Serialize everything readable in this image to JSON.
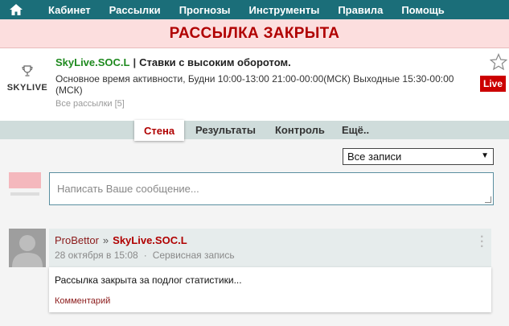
{
  "nav": {
    "home_icon": "home-icon",
    "items": [
      "Кабинет",
      "Рассылки",
      "Прогнозы",
      "Инструменты",
      "Правила",
      "Помощь"
    ]
  },
  "banner": {
    "text": "РАССЫЛКА ЗАКРЫТА",
    "color": "#b00000"
  },
  "channel": {
    "logo_text": "SKYLIVE",
    "name": "SkyLive.SOC.L",
    "separator": "|",
    "description": "Ставки с высоким оборотом.",
    "active_time": "Основное время активности, Будни 10:00-13:00 21:00-00:00(МСК) Выходные 15:30-00:00 (МСК)",
    "all_mailings": "Все рассылки [5]",
    "live_badge": "Live",
    "live_color": "#cc0000",
    "name_color": "#1f8a1f"
  },
  "tabs": [
    {
      "label": "Стена",
      "active": true
    },
    {
      "label": "Результаты",
      "active": false
    },
    {
      "label": "Контроль",
      "active": false
    },
    {
      "label": "Ещё..",
      "active": false
    }
  ],
  "filter": {
    "selected": "Все записи"
  },
  "composer": {
    "placeholder": "Написать Ваше сообщение..."
  },
  "post": {
    "author": "ProBettor",
    "arrow": "»",
    "channel": "SkyLive.SOC.L",
    "date": "28 октября в 15:08",
    "dot": "·",
    "type": "Сервисная запись",
    "text": "Рассылка закрыта за подлог статистики...",
    "comment_link": "Комментарий"
  }
}
